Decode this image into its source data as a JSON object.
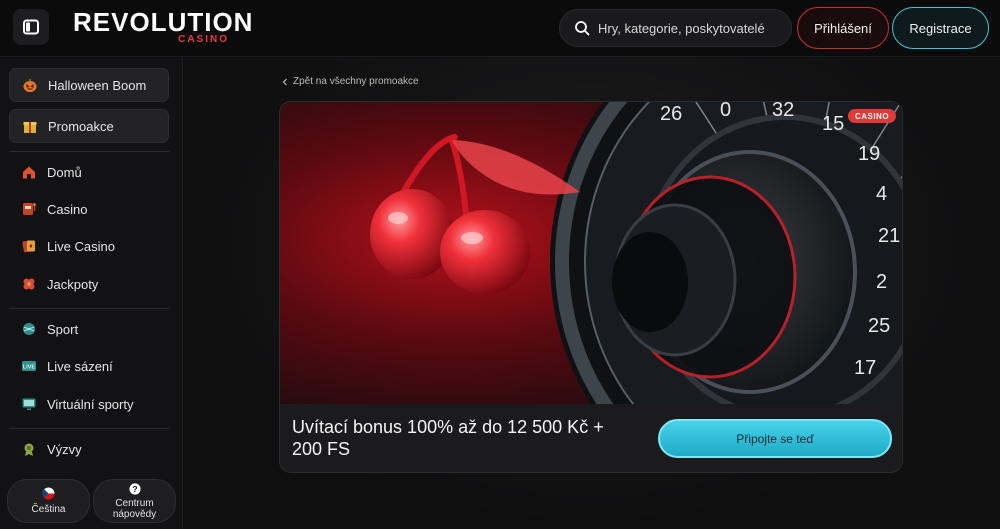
{
  "header": {
    "logo_main": "REVOLUTION",
    "logo_sub": "CASINO",
    "search_placeholder": "Hry, kategorie, poskytovatelé",
    "login_label": "Přihlášení",
    "register_label": "Registrace"
  },
  "sidebar": {
    "items": [
      {
        "label": "Halloween Boom",
        "icon": "pumpkin-icon"
      },
      {
        "label": "Promoakce",
        "icon": "gift-icon"
      },
      {
        "label": "Domů",
        "icon": "home-icon"
      },
      {
        "label": "Casino",
        "icon": "slot-machine-icon"
      },
      {
        "label": "Live Casino",
        "icon": "live-cards-icon"
      },
      {
        "label": "Jackpoty",
        "icon": "clover-icon"
      },
      {
        "label": "Sport",
        "icon": "sport-ball-icon"
      },
      {
        "label": "Live sázení",
        "icon": "live-badge-icon"
      },
      {
        "label": "Virtuální sporty",
        "icon": "monitor-icon"
      },
      {
        "label": "Výzvy",
        "icon": "medal-icon"
      }
    ],
    "language_label": "Čeština",
    "help_label_line1": "Centrum",
    "help_label_line2": "nápovědy"
  },
  "main": {
    "back_link": "Zpět na všechny promoakce",
    "badge": "CASINO",
    "promo_title": "Uvítací bonus 100% až do 12 500 Kč + 200 FS",
    "join_label": "Připojte se teď"
  },
  "colors": {
    "accent_red": "#e23a36",
    "accent_cyan": "#3cc7d6",
    "background": "#0f0f10"
  }
}
